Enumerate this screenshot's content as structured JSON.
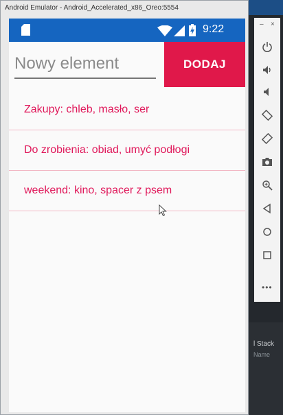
{
  "window": {
    "title": "Android Emulator - Android_Accelerated_x86_Oreo:5554"
  },
  "status_bar": {
    "time": "9:22"
  },
  "input": {
    "placeholder": "Nowy element"
  },
  "add_button": {
    "label": "DODAJ"
  },
  "list": {
    "items": [
      "Zakupy: chleb, masło, ser",
      "Do zrobienia: obiad, umyć podłogi",
      "weekend: kino, spacer z psem"
    ]
  },
  "toolbar": {
    "minimize": "–",
    "close": "×",
    "more": "•••"
  },
  "ide": {
    "stack_label": "l Stack",
    "name_label": "Name"
  },
  "colors": {
    "status_bar": "#1565c0",
    "accent": "#e0184a",
    "list_text": "#e0185a"
  }
}
